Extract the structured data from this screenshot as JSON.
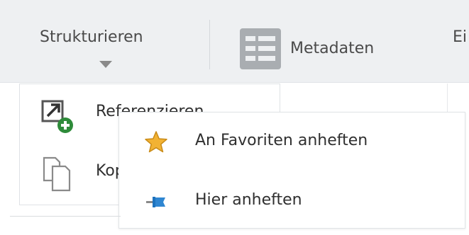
{
  "ribbon": {
    "tabs": [
      {
        "label": "Strukturieren",
        "icon": "chevron-down-icon"
      },
      {
        "label": "Metadaten",
        "icon": "table-icon"
      },
      {
        "label": "Ei"
      }
    ]
  },
  "dropdown": {
    "items": [
      {
        "label": "Referenzieren",
        "icon": "reference-add-icon"
      },
      {
        "label": "Kopieren",
        "icon": "copy-icon"
      }
    ]
  },
  "submenu": {
    "items": [
      {
        "label": "An Favoriten anheften",
        "icon": "star-icon"
      },
      {
        "label": "Hier anheften",
        "icon": "pin-icon"
      }
    ]
  },
  "colors": {
    "ribbon_bg": "#eef0f2",
    "text": "#2f2f2f",
    "star": "#f2b233",
    "pin": "#1e73be",
    "badge_green": "#2e8b3a"
  }
}
